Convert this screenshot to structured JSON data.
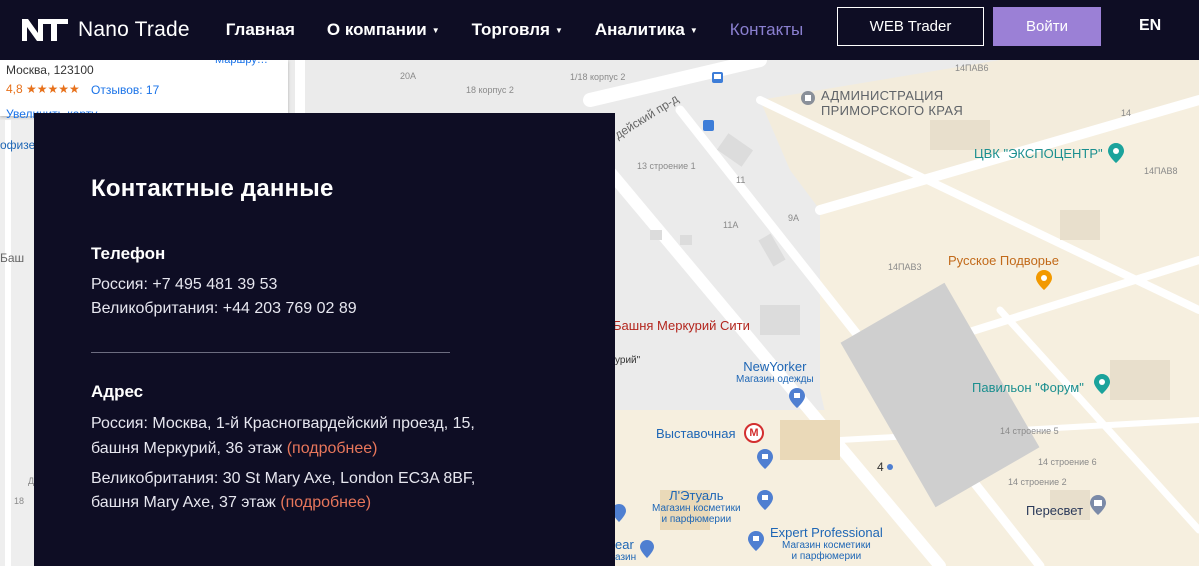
{
  "header": {
    "brand": "Nano Trade",
    "nav": [
      {
        "label": "Главная",
        "dropdown": false,
        "active": false
      },
      {
        "label": "О компании",
        "dropdown": true,
        "active": false
      },
      {
        "label": "Торговля",
        "dropdown": true,
        "active": false
      },
      {
        "label": "Аналитика",
        "dropdown": true,
        "active": false
      },
      {
        "label": "Контакты",
        "dropdown": false,
        "active": true
      }
    ],
    "caret": "▼",
    "web_trader": "WEB Trader",
    "login": "Войти",
    "lang": "EN"
  },
  "map_card": {
    "address": "Москва, 123100",
    "rating": "4,8 ★★★★★",
    "reviews": "Отзывов: 17",
    "enlarge": "Увеличить карту",
    "route_cut": "Маршру…"
  },
  "map": {
    "labels": {
      "b20a": "20А",
      "b18k2": "18 корпус 2",
      "b1_18k2": "1/18 корпус 2",
      "admin1": "АДМИНИСТРАЦИЯ",
      "admin2": "ПРИМОРСКОГО КРАЯ",
      "b14pav6": "14ПАВ6",
      "b14": "14",
      "cvk": "ЦВК \"ЭКСПОЦЕНТР\"",
      "b14pav8": "14ПАВ8",
      "street": "дейский пр-д",
      "b13s1": "13 строение 1",
      "b11": "11",
      "b9a": "9А",
      "b11a": "11А",
      "b14pav3": "14ПАВ3",
      "russkoe": "Русское Подворье",
      "mercury": "Башня Меркурий Сити",
      "riy": "урий\"",
      "newyorker": "NewYorker",
      "newyorker_sub": "Магазин одежды",
      "pavilion": "Павильон \"Форум\"",
      "b14s5": "14 строение 5",
      "vystavochnaya": "Выставочная",
      "metro": "М",
      "b4": "4",
      "b14s6": "14 строение 6",
      "b14s2": "14 строение 2",
      "etual": "Л'Этуаль",
      "etual_sub1": "Магазин косметики",
      "etual_sub2": "и парфюмерии",
      "peresvet": "Пересвет",
      "expert": "Expert Professional",
      "expert_sub1": "Магазин косметики",
      "expert_sub2": "и парфюмерии",
      "ofize": "офизе",
      "bash": "Баш",
      "ear": "ear",
      "azin": "азин",
      "b18": "18",
      "bD": "Д"
    }
  },
  "contacts": {
    "title": "Контактные данные",
    "phone_title": "Телефон",
    "phone_ru": "Россия: +7 495 481 39 53",
    "phone_uk": "Великобритания: +44 203 769 02 89",
    "address_title": "Адрес",
    "addr_ru_1": "Россия: Москва, 1-й Красногвардейский проезд, 15,",
    "addr_ru_2": "башня Меркурий, 36 этаж",
    "addr_uk_1": "Великобритания: 30 St Mary Axe, London EC3A 8BF,",
    "addr_uk_2": "башня Mary Axe, 37 этаж",
    "more": "(подробнее)"
  }
}
